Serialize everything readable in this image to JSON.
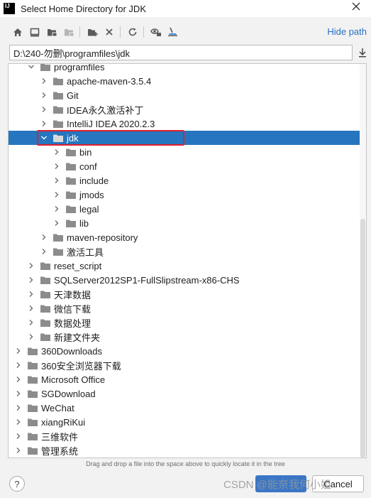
{
  "window": {
    "title": "Select Home Directory for JDK",
    "logo_text": "IJ"
  },
  "toolbar": {
    "buttons": [
      "home-icon",
      "desktop-icon",
      "project-folder-icon",
      "module-folder-icon",
      "new-folder-icon",
      "delete-icon",
      "refresh-icon",
      "show-hidden-icon",
      "lambda-icon"
    ],
    "hide_path_label": "Hide path"
  },
  "path": {
    "value": "D:\\240-勿删\\programfiles\\jdk"
  },
  "tree": {
    "rows": [
      {
        "label": "programfiles",
        "depth": 2,
        "expanded": true
      },
      {
        "label": "apache-maven-3.5.4",
        "depth": 3,
        "expanded": false
      },
      {
        "label": "Git",
        "depth": 3,
        "expanded": false
      },
      {
        "label": "IDEA永久激活补丁",
        "depth": 3,
        "expanded": false
      },
      {
        "label": "IntelliJ IDEA 2020.2.3",
        "depth": 3,
        "expanded": false
      },
      {
        "label": "jdk",
        "depth": 3,
        "expanded": true,
        "selected": true
      },
      {
        "label": "bin",
        "depth": 4,
        "expanded": false
      },
      {
        "label": "conf",
        "depth": 4,
        "expanded": false
      },
      {
        "label": "include",
        "depth": 4,
        "expanded": false
      },
      {
        "label": "jmods",
        "depth": 4,
        "expanded": false
      },
      {
        "label": "legal",
        "depth": 4,
        "expanded": false
      },
      {
        "label": "lib",
        "depth": 4,
        "expanded": false
      },
      {
        "label": "maven-repository",
        "depth": 3,
        "expanded": false
      },
      {
        "label": "激活工具",
        "depth": 3,
        "expanded": false
      },
      {
        "label": "reset_script",
        "depth": 2,
        "expanded": false
      },
      {
        "label": "SQLServer2012SP1-FullSlipstream-x86-CHS",
        "depth": 2,
        "expanded": false
      },
      {
        "label": "天津数据",
        "depth": 2,
        "expanded": false
      },
      {
        "label": "微信下载",
        "depth": 2,
        "expanded": false
      },
      {
        "label": "数据处理",
        "depth": 2,
        "expanded": false
      },
      {
        "label": "新建文件夹",
        "depth": 2,
        "expanded": false
      },
      {
        "label": "360Downloads",
        "depth": 1,
        "expanded": false
      },
      {
        "label": "360安全浏览器下载",
        "depth": 1,
        "expanded": false
      },
      {
        "label": "Microsoft Office",
        "depth": 1,
        "expanded": false
      },
      {
        "label": "SGDownload",
        "depth": 1,
        "expanded": false
      },
      {
        "label": "WeChat",
        "depth": 1,
        "expanded": false
      },
      {
        "label": "xiangRiKui",
        "depth": 1,
        "expanded": false
      },
      {
        "label": "三维软件",
        "depth": 1,
        "expanded": false
      },
      {
        "label": "管理系统",
        "depth": 1,
        "expanded": false
      }
    ]
  },
  "footer": {
    "hint": "Drag and drop a file into the space above to quickly locate it in the tree",
    "help_label": "?",
    "ok_label": "OK",
    "cancel_label": "Cancel",
    "watermark": "CSDN @能奈我何小姐"
  },
  "colors": {
    "selection": "#2675bf",
    "highlight_box": "#e0212b",
    "link": "#2470c2",
    "folder": "#8c8c8c"
  }
}
